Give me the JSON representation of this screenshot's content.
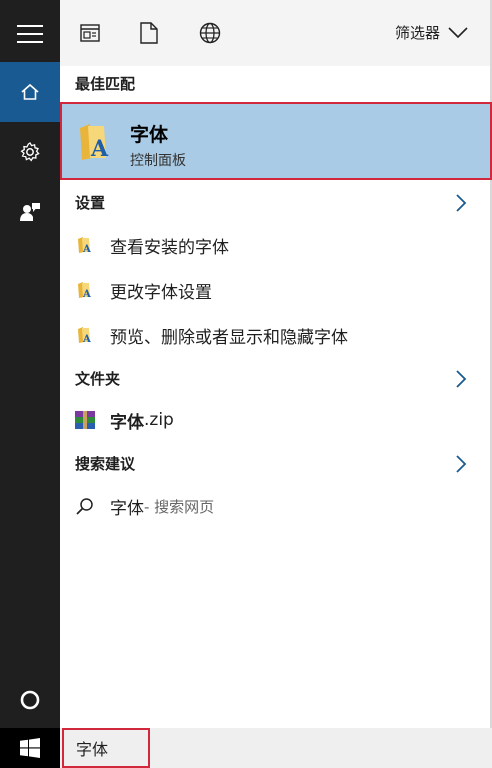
{
  "toolbar": {
    "filter_label": "筛选器"
  },
  "sections": {
    "best_match": "最佳匹配",
    "settings": "设置",
    "folders": "文件夹",
    "suggestions": "搜索建议"
  },
  "best_match": {
    "title": "字体",
    "subtitle": "控制面板"
  },
  "settings_items": [
    {
      "label": "查看安装的字体"
    },
    {
      "label": "更改字体设置"
    },
    {
      "label": "预览、删除或者显示和隐藏字体"
    }
  ],
  "folder_item": {
    "name_bold": "字体",
    "name_ext": ".zip"
  },
  "suggestion_item": {
    "query": "字体",
    "suffix": " - 搜索网页"
  },
  "search": {
    "value": "字体"
  },
  "colors": {
    "accent": "#1a5a93",
    "selection": "#aacbe6",
    "highlight_border": "#d2283d"
  }
}
